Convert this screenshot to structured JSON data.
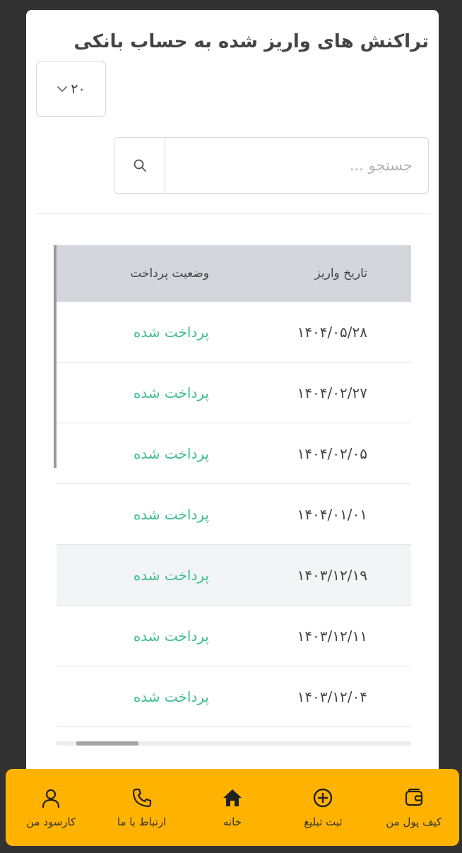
{
  "page": {
    "title": "تراکنش های واریز شده به حساب بانکی"
  },
  "page_size": {
    "value": "۲۰"
  },
  "search": {
    "placeholder": "جستجو ..."
  },
  "table": {
    "headers": {
      "date": "تاریخ واریز",
      "status": "وضعیت پرداخت"
    },
    "rows": [
      {
        "date": "۱۴۰۴/۰۵/۲۸",
        "status": "پرداخت شده"
      },
      {
        "date": "۱۴۰۴/۰۲/۲۷",
        "status": "پرداخت شده"
      },
      {
        "date": "۱۴۰۴/۰۲/۰۵",
        "status": "پرداخت شده"
      },
      {
        "date": "۱۴۰۴/۰۱/۰۱",
        "status": "پرداخت شده"
      },
      {
        "date": "۱۴۰۳/۱۲/۱۹",
        "status": "پرداخت شده"
      },
      {
        "date": "۱۴۰۳/۱۲/۱۱",
        "status": "پرداخت شده"
      },
      {
        "date": "۱۴۰۳/۱۲/۰۴",
        "status": "پرداخت شده"
      }
    ]
  },
  "nav": {
    "wallet": "کیف پول من",
    "add_ad": "ثبت تبلیغ",
    "home": "خانه",
    "contact": "ارتباط با ما",
    "profile": "کارسود من"
  },
  "colors": {
    "accent_nav": "#ffb300",
    "status_paid": "#3fbf8f",
    "table_header_bg": "#d3d6dd"
  },
  "icons": {
    "page_size": "chevron-down-icon",
    "search": "search-icon",
    "wallet": "wallet-icon",
    "add_ad": "plus-circle-icon",
    "home": "home-icon",
    "contact": "phone-icon",
    "profile": "user-icon"
  }
}
